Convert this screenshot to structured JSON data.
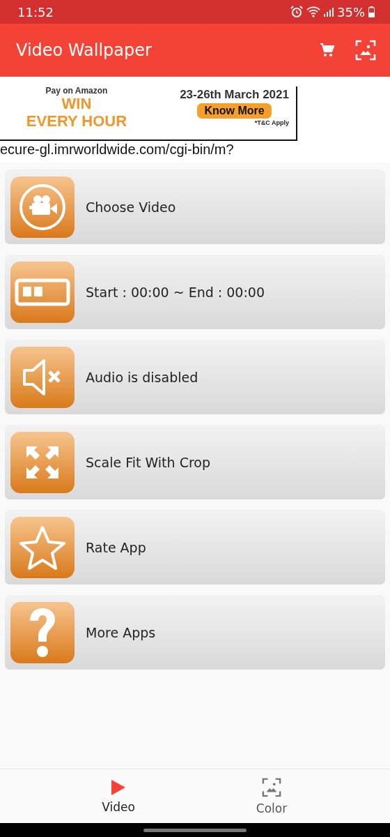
{
  "status_bar": {
    "time": "11:52",
    "battery": "35%"
  },
  "app_bar": {
    "title": "Video Wallpaper"
  },
  "ad": {
    "top_line": "Pay on Amazon",
    "headline_1": "WIN",
    "headline_2": "EVERY HOUR",
    "dates": "23-26th March 2021",
    "cta": "Know More",
    "fine_print": "*T&C Apply",
    "url": "ecure-gl.imrworldwide.com/cgi-bin/m?"
  },
  "menu": [
    {
      "kind": "video",
      "label": "Choose Video"
    },
    {
      "kind": "range",
      "label": "Start : 00:00 ~ End : 00:00"
    },
    {
      "kind": "mute",
      "label": "Audio is disabled"
    },
    {
      "kind": "scale",
      "label": "Scale Fit With Crop"
    },
    {
      "kind": "star",
      "label": "Rate App"
    },
    {
      "kind": "help",
      "label": "More Apps"
    }
  ],
  "bottom_nav": [
    {
      "kind": "play",
      "label": "Video",
      "selected": true
    },
    {
      "kind": "image",
      "label": "Color",
      "selected": false
    }
  ]
}
